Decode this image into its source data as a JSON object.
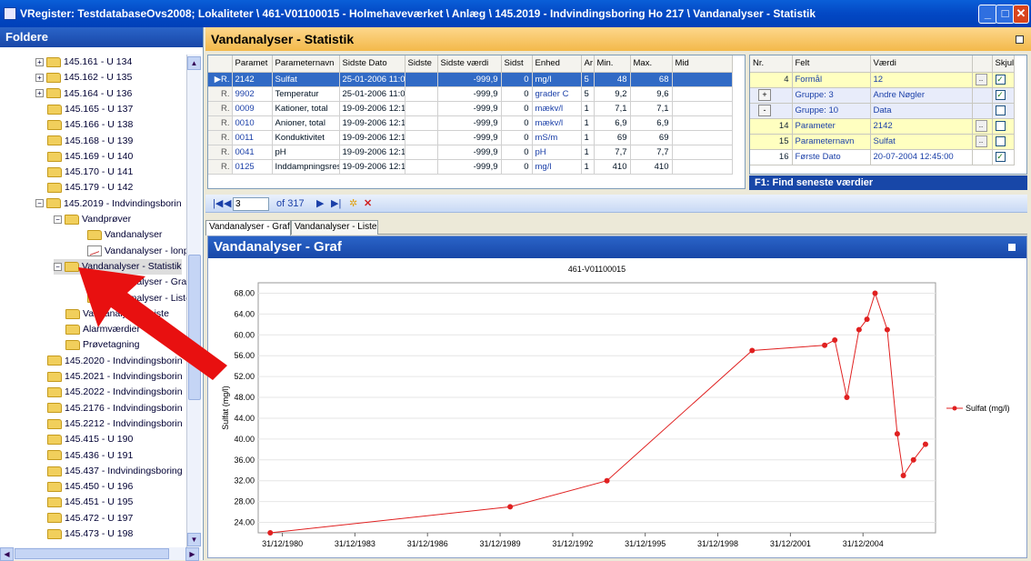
{
  "window": {
    "title": "VRegister: TestdatabaseOvs2008; Lokaliteter \\ 461-V01100015 - Holmehaveværket \\ Anlæg \\ 145.2019 - Indvindingsboring Ho 217 \\ Vandanalyser - Statistik",
    "controls": {
      "minimize": "_",
      "maximize": "□",
      "close": "✕"
    }
  },
  "folders": {
    "header": "Foldere",
    "items": [
      {
        "label": "145.161 - U 134",
        "depth": 1,
        "exp": "+"
      },
      {
        "label": "145.162 - U 135",
        "depth": 1,
        "exp": "+"
      },
      {
        "label": "145.164 - U 136",
        "depth": 1,
        "exp": "+"
      },
      {
        "label": "145.165 - U 137",
        "depth": 1,
        "exp": ""
      },
      {
        "label": "145.166 - U 138",
        "depth": 1,
        "exp": ""
      },
      {
        "label": "145.168 - U 139",
        "depth": 1,
        "exp": ""
      },
      {
        "label": "145.169 - U 140",
        "depth": 1,
        "exp": ""
      },
      {
        "label": "145.170 - U 141",
        "depth": 1,
        "exp": ""
      },
      {
        "label": "145.179 - U 142",
        "depth": 1,
        "exp": ""
      },
      {
        "label": "145.2019 - Indvindingsborin",
        "depth": 1,
        "exp": "-"
      },
      {
        "label": "Vandprøver",
        "depth": 2,
        "exp": "-"
      },
      {
        "label": "Vandanalyser",
        "depth": 3,
        "exp": ""
      },
      {
        "label": "Vandanalyser - lonp",
        "depth": 3,
        "exp": "",
        "icon": "chart"
      },
      {
        "label": "Vandanalyser - Statistik",
        "depth": 2,
        "exp": "-",
        "selected": true
      },
      {
        "label": "Vandanalyser - Graf",
        "depth": 3,
        "exp": ""
      },
      {
        "label": "Vandanalyser - Liste",
        "depth": 3,
        "exp": ""
      },
      {
        "label": "Vandanalyser - Liste",
        "depth": 2,
        "exp": ""
      },
      {
        "label": "Alarmværdier",
        "depth": 2,
        "exp": ""
      },
      {
        "label": "Prøvetagning",
        "depth": 2,
        "exp": ""
      },
      {
        "label": "145.2020 - Indvindingsborin",
        "depth": 1,
        "exp": ""
      },
      {
        "label": "145.2021 - Indvindingsborin",
        "depth": 1,
        "exp": ""
      },
      {
        "label": "145.2022 - Indvindingsborin",
        "depth": 1,
        "exp": ""
      },
      {
        "label": "145.2176 - Indvindingsborin",
        "depth": 1,
        "exp": ""
      },
      {
        "label": "145.2212 - Indvindingsborin",
        "depth": 1,
        "exp": ""
      },
      {
        "label": "145.415 - U 190",
        "depth": 1,
        "exp": ""
      },
      {
        "label": "145.436 - U 191",
        "depth": 1,
        "exp": ""
      },
      {
        "label": "145.437 - Indvindingsboring",
        "depth": 1,
        "exp": ""
      },
      {
        "label": "145.450 - U 196",
        "depth": 1,
        "exp": ""
      },
      {
        "label": "145.451 - U 195",
        "depth": 1,
        "exp": ""
      },
      {
        "label": "145.472 - U 197",
        "depth": 1,
        "exp": ""
      },
      {
        "label": "145.473 - U 198",
        "depth": 1,
        "exp": ""
      }
    ]
  },
  "main": {
    "header": "Vandanalyser - Statistik"
  },
  "grid": {
    "columns": [
      "Paramet",
      "Parameternavn",
      "Sidste Dato",
      "Sidste",
      "Sidste værdi",
      "Sidst",
      "Enhed",
      "Ar",
      "Min.",
      "Max.",
      "Mid"
    ],
    "rows": [
      {
        "marker": "▶R.",
        "id": "2142",
        "name": "Sulfat",
        "date": "25-01-2006 11:00",
        "val": "-999,9",
        "s": "0",
        "unit": "mg/l",
        "ar": "5",
        "min": "48",
        "max": "68",
        "selected": true
      },
      {
        "marker": "R.",
        "id": "9902",
        "name": "Temperatur",
        "date": "25-01-2006 11:00",
        "val": "-999,9",
        "s": "0",
        "unit": "grader C",
        "ar": "5",
        "min": "9,2",
        "max": "9,6"
      },
      {
        "marker": "R.",
        "id": "0009",
        "name": "Kationer, total",
        "date": "19-09-2006 12:15",
        "val": "-999,9",
        "s": "0",
        "unit": "mækv/l",
        "ar": "1",
        "min": "7,1",
        "max": "7,1"
      },
      {
        "marker": "R.",
        "id": "0010",
        "name": "Anioner, total",
        "date": "19-09-2006 12:15",
        "val": "-999,9",
        "s": "0",
        "unit": "mækv/l",
        "ar": "1",
        "min": "6,9",
        "max": "6,9"
      },
      {
        "marker": "R.",
        "id": "0011",
        "name": "Konduktivitet",
        "date": "19-09-2006 12:15",
        "val": "-999,9",
        "s": "0",
        "unit": "mS/m",
        "ar": "1",
        "min": "69",
        "max": "69"
      },
      {
        "marker": "R.",
        "id": "0041",
        "name": "pH",
        "date": "19-09-2006 12:15",
        "val": "-999,9",
        "s": "0",
        "unit": "pH",
        "ar": "1",
        "min": "7,7",
        "max": "7,7"
      },
      {
        "marker": "R.",
        "id": "0125",
        "name": "Inddampningsrest",
        "date": "19-09-2006 12:15",
        "val": "-999,9",
        "s": "0",
        "unit": "mg/l",
        "ar": "1",
        "min": "410",
        "max": "410"
      }
    ]
  },
  "properties": {
    "columns": [
      "Nr.",
      "Felt",
      "Værdi",
      "",
      "Skjul"
    ],
    "rows": [
      {
        "nr": "4",
        "felt": "Formål",
        "vaerdi": "12",
        "dd": true,
        "checked": true,
        "style": "y"
      },
      {
        "nr": "+",
        "felt": "Gruppe: 3",
        "vaerdi": "Andre Nøgler",
        "dd": false,
        "checked": true,
        "style": "b",
        "btn": true
      },
      {
        "nr": "-",
        "felt": "Gruppe: 10",
        "vaerdi": "Data",
        "dd": false,
        "checked": false,
        "style": "b",
        "btn": true
      },
      {
        "nr": "14",
        "felt": "Parameter",
        "vaerdi": "2142",
        "dd": true,
        "checked": false,
        "style": "y"
      },
      {
        "nr": "15",
        "felt": "Parameternavn",
        "vaerdi": "Sulfat",
        "dd": true,
        "checked": false,
        "style": "y"
      },
      {
        "nr": "16",
        "felt": "Første Dato",
        "vaerdi": "20-07-2004 12:45:00",
        "dd": false,
        "checked": true,
        "style": ""
      }
    ],
    "footer": "F1: Find seneste værdier"
  },
  "navigator": {
    "position": "3",
    "of": "of 317"
  },
  "tabs": {
    "graf": "Vandanalyser - Graf",
    "liste": "Vandanalyser - Liste"
  },
  "graph": {
    "header": "Vandanalyser - Graf"
  },
  "chart_data": {
    "type": "line",
    "title": "461-V01100015",
    "ylabel": "Sulfat (mg/l)",
    "ylim": [
      22,
      70
    ],
    "yticks": [
      "24.00",
      "28.00",
      "32.00",
      "36.00",
      "40.00",
      "44.00",
      "48.00",
      "52.00",
      "56.00",
      "60.00",
      "64.00",
      "68.00"
    ],
    "xticks": [
      "31/12/1980",
      "31/12/1983",
      "31/12/1986",
      "31/12/1989",
      "31/12/1992",
      "31/12/1995",
      "31/12/1998",
      "31/12/2001",
      "31/12/2004"
    ],
    "xrange": [
      "1980-01-01",
      "2007-12-31"
    ],
    "series": [
      {
        "name": "Sulfat (mg/l)",
        "color": "#e02020",
        "points": [
          [
            "1980-07-01",
            22
          ],
          [
            "1990-06-01",
            27
          ],
          [
            "1994-06-01",
            32
          ],
          [
            "2000-06-01",
            57
          ],
          [
            "2003-06-01",
            58
          ],
          [
            "2003-11-01",
            59
          ],
          [
            "2004-05-01",
            48
          ],
          [
            "2004-11-01",
            61
          ],
          [
            "2005-03-01",
            63
          ],
          [
            "2005-07-01",
            68
          ],
          [
            "2006-01-01",
            61
          ],
          [
            "2006-06-01",
            41
          ],
          [
            "2006-09-01",
            33
          ],
          [
            "2007-02-01",
            36
          ],
          [
            "2007-08-01",
            39
          ]
        ]
      }
    ]
  }
}
